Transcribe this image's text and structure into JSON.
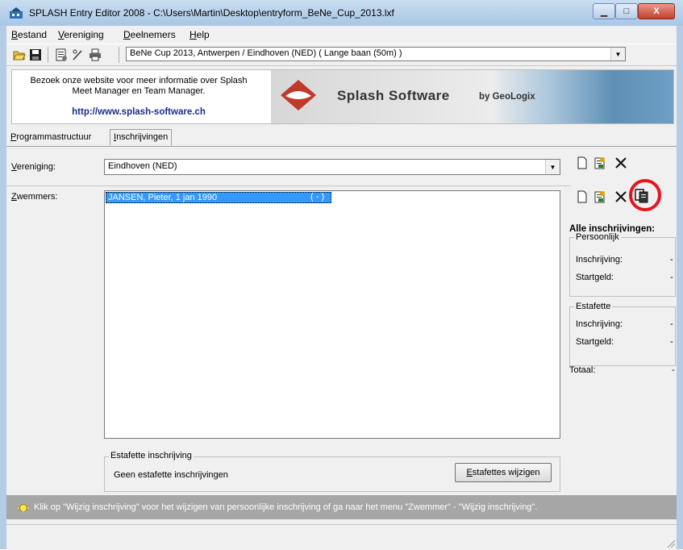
{
  "window": {
    "title": "SPLASH Entry Editor 2008 - C:\\Users\\Martin\\Desktop\\entryform_BeNe_Cup_2013.lxf",
    "minimize_glyph": "▁",
    "maximize_glyph": "□",
    "close_glyph": "X"
  },
  "menu": {
    "items": [
      {
        "first": "B",
        "rest": "estand"
      },
      {
        "first": "V",
        "rest": "ereniging"
      },
      {
        "first": "D",
        "rest": "eelnemers"
      },
      {
        "first": "H",
        "rest": "elp"
      }
    ]
  },
  "toolbar": {
    "icons": [
      "open-folder-icon",
      "save-disk-icon",
      "properties-icon",
      "wand-icon",
      "print-icon"
    ],
    "meet_selected": "BeNe Cup 2013,  Antwerpen / Eindhoven  (NED)   ( Lange baan (50m) )"
  },
  "banner": {
    "line1": "Bezoek onze website voor meer informatie over Splash",
    "line2": "Meet Manager en Team Manager.",
    "link": "http://www.splash-software.ch",
    "logo_text": "Splash Software",
    "logo_by": "by GeoLogix"
  },
  "tabs": [
    {
      "first": "P",
      "rest": "rogrammastructuur"
    },
    {
      "first": "I",
      "rest": "nschrijvingen"
    }
  ],
  "form": {
    "vereniging_label_first": "V",
    "vereniging_label_rest": "ereniging:",
    "vereniging_value": "Eindhoven (NED)",
    "zwemmers_label_first": "Z",
    "zwemmers_label_rest": "wemmers:",
    "swimmers": [
      {
        "name": "JANSEN, Pieter, 1 jan 1990",
        "status": "( - )"
      }
    ]
  },
  "estafette": {
    "group_title": "Estafette inschrijving",
    "none_text": "Geen estafette inschrijvingen",
    "button_first": "E",
    "button_rest": "stafettes wijzigen"
  },
  "summary": {
    "title": "Alle inschrijvingen:",
    "persoonlijk_title": "Persoonlijk",
    "estafette_title": "Estafette",
    "inschrijving_label": "Inschrijving:",
    "startgeld_label": "Startgeld:",
    "totaal_label": "Totaal:",
    "persoonlijk_inschrijving": "-",
    "persoonlijk_startgeld": "-",
    "estafette_inschrijving": "-",
    "estafette_startgeld": "-",
    "totaal": "-"
  },
  "status": {
    "text": "Klik op \"Wijzig inschrijving\" voor het wijzigen van persoonlijke inschrijving of ga naar het menu \"Zwemmer\" - \"Wijzig inschrijving\"."
  },
  "colors": {
    "highlight_circle": "#e8131d",
    "selection": "#3399ff",
    "link": "#1c2d8c"
  }
}
